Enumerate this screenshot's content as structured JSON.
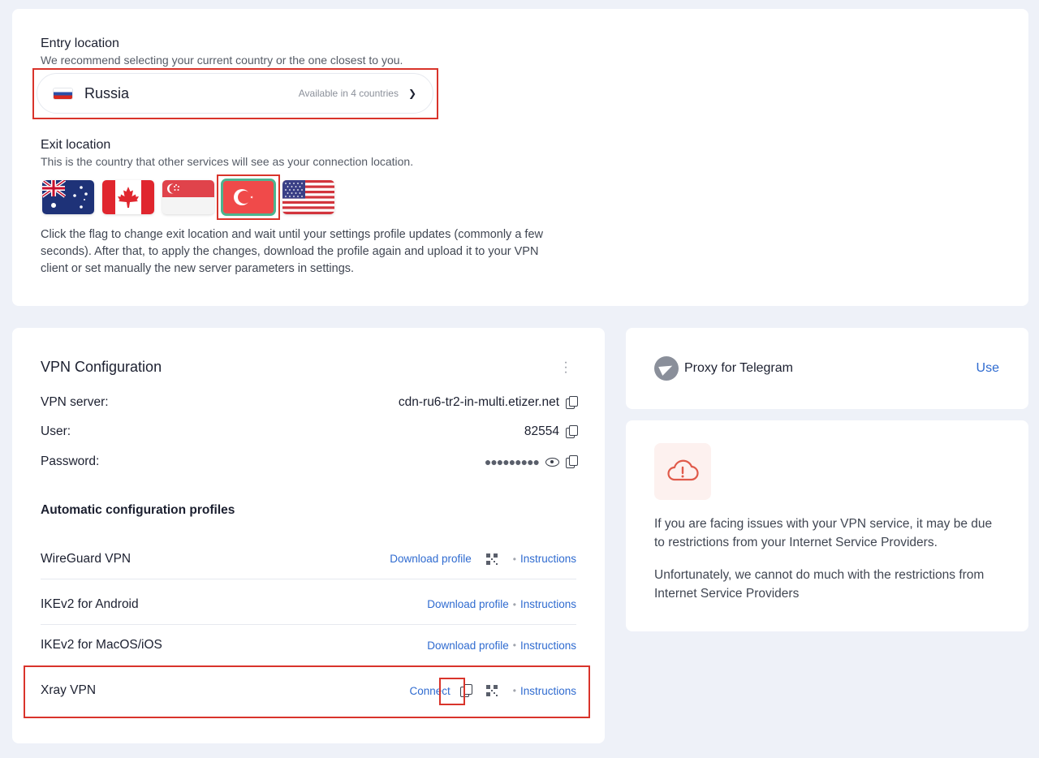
{
  "entry": {
    "title": "Entry location",
    "subtitle": "We recommend selecting your current country or the one closest to you.",
    "selected": "Russia",
    "meta": "Available in 4 countries"
  },
  "exit": {
    "title": "Exit location",
    "subtitle": "This is the country that other services will see as your connection location.",
    "flags": [
      "australia",
      "canada",
      "singapore",
      "turkey",
      "united-states"
    ],
    "selected_flag": "turkey",
    "note": "Click the flag to change exit location and wait until your settings profile updates (commonly a few seconds). After that, to apply the changes, download the profile again and upload it to your VPN client or set manually the new server parameters in settings."
  },
  "vpn": {
    "title": "VPN Configuration",
    "server_label": "VPN server:",
    "server_value": "cdn-ru6-tr2-in-multi.etizer.net",
    "user_label": "User:",
    "user_value": "82554",
    "password_label": "Password:",
    "password_mask": "●●●●●●●●●",
    "auto_title": "Automatic configuration profiles",
    "profiles": [
      {
        "name": "WireGuard VPN",
        "action": "Download profile",
        "instructions": "Instructions"
      },
      {
        "name": "IKEv2 for Android",
        "action": "Download profile",
        "instructions": "Instructions"
      },
      {
        "name": "IKEv2 for MacOS/iOS",
        "action": "Download profile",
        "instructions": "Instructions"
      },
      {
        "name": "Xray VPN",
        "action": "Connect",
        "instructions": "Instructions"
      }
    ]
  },
  "telegram": {
    "label": "Proxy for Telegram",
    "action": "Use"
  },
  "info": {
    "p1": "If you are facing issues with your VPN service, it may be due to restrictions from your Internet Service Providers.",
    "p2": "Unfortunately, we cannot do much with the restrictions from Internet Service Providers"
  },
  "colors": {
    "accent_link": "#2f6bd0",
    "highlight": "#d9342b",
    "selected_flag_outline": "#4db48f",
    "page_bg": "#eef1f8"
  }
}
